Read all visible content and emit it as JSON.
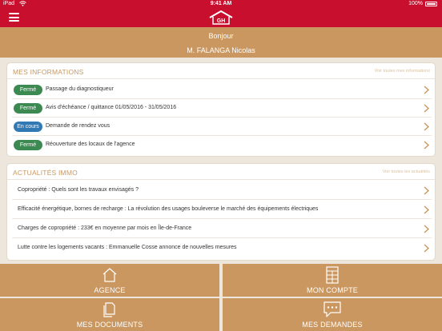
{
  "status_bar": {
    "carrier": "iPad",
    "time": "9:41 AM",
    "battery": "100%"
  },
  "header": {
    "menu_icon": "hamburger-menu-icon",
    "logo_icon": "house-logo-icon",
    "logo_text": "GH"
  },
  "greeting": {
    "hello": "Bonjour",
    "name": "M. FALANGA Nicolas"
  },
  "colors": {
    "header_red": "#c8102e",
    "accent_gold": "#c9975f",
    "status_closed": "#3c8a52",
    "status_in_progress": "#3179b5"
  },
  "informations": {
    "title": "MES INFORMATIONS",
    "see_all": "Voir toutes mes informations",
    "items": [
      {
        "status": "Fermé",
        "status_type": "closed",
        "text": "Passage du diagnostiqueur"
      },
      {
        "status": "Fermé",
        "status_type": "closed",
        "text": "Avis d'échéance / quittance 01/05/2016 - 31/05/2016"
      },
      {
        "status": "En cours",
        "status_type": "open",
        "text": "Demande de rendez vous"
      },
      {
        "status": "Fermé",
        "status_type": "closed",
        "text": "Réouverture des locaux de l'agence"
      }
    ]
  },
  "news": {
    "title": "ACTUALITÉS IMMO",
    "see_all": "Voir toutes les actualités",
    "items": [
      {
        "text": "Copropriété : Quels sont les travaux envisagés ?"
      },
      {
        "text": "Efficacité énergétique, bornes de recharge : La révolution des usages bouleverse le marché des équipements électriques"
      },
      {
        "text": "Charges de copropriété : 233€ en moyenne par mois en Île-de-France"
      },
      {
        "text": "Lutte contre les logements vacants : Emmanuelle Cosse annonce de nouvelles mesures"
      }
    ]
  },
  "tiles": [
    {
      "label": "AGENCE",
      "icon": "house-icon"
    },
    {
      "label": "MON COMPTE",
      "icon": "building-icon"
    },
    {
      "label": "MES DOCUMENTS",
      "icon": "documents-icon"
    },
    {
      "label": "MES DEMANDES",
      "icon": "chat-bubble-icon"
    }
  ]
}
